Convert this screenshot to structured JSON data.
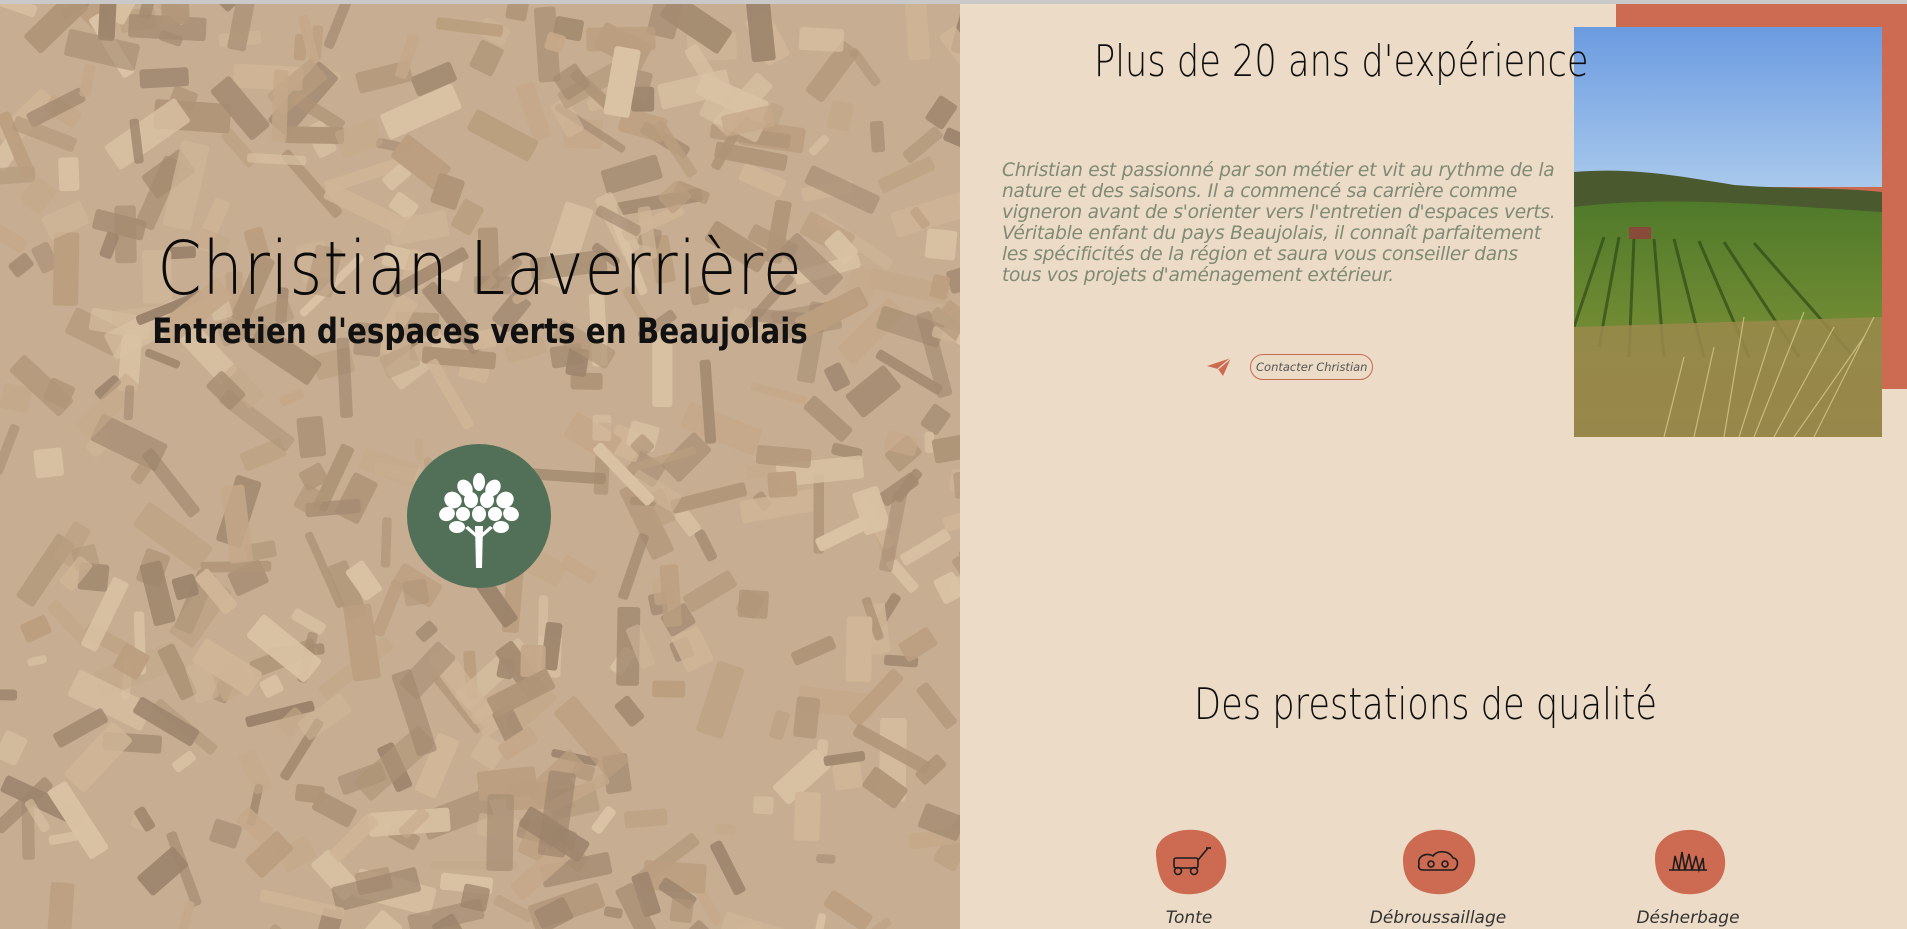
{
  "hero": {
    "title": "Christian Laverrière",
    "subtitle": "Entretien d'espaces verts en Beaujolais",
    "logo_icon": "tree-icon",
    "background": "wood-mulch-image"
  },
  "about": {
    "title": "Plus de 20 ans d'expérience",
    "text": "Christian est passionné par son métier et vit au rythme de la nature et des saisons. Il a commencé sa carrière comme vigneron avant de s'orienter vers l'entretien d'espaces verts. Véritable enfant du pays Beaujolais, il connaît parfaitement les spécificités de la région et saura vous conseiller dans tous vos projets d'aménagement extérieur.",
    "contact_icon": "paper-plane-icon",
    "contact_label": "Contacter Christian",
    "photo": "vineyard-landscape-photo"
  },
  "services": {
    "title": "Des prestations de qualité",
    "items": [
      {
        "label": "Tonte",
        "icon": "lawn-mower-icon"
      },
      {
        "label": "Débroussaillage",
        "icon": "brushcutter-icon"
      },
      {
        "label": "Désherbage",
        "icon": "grass-icon"
      }
    ]
  },
  "colors": {
    "page_bg": "#ecdcc7",
    "accent": "#cd6b52",
    "logo_green": "#527057",
    "body_text": "#7f8a75"
  }
}
